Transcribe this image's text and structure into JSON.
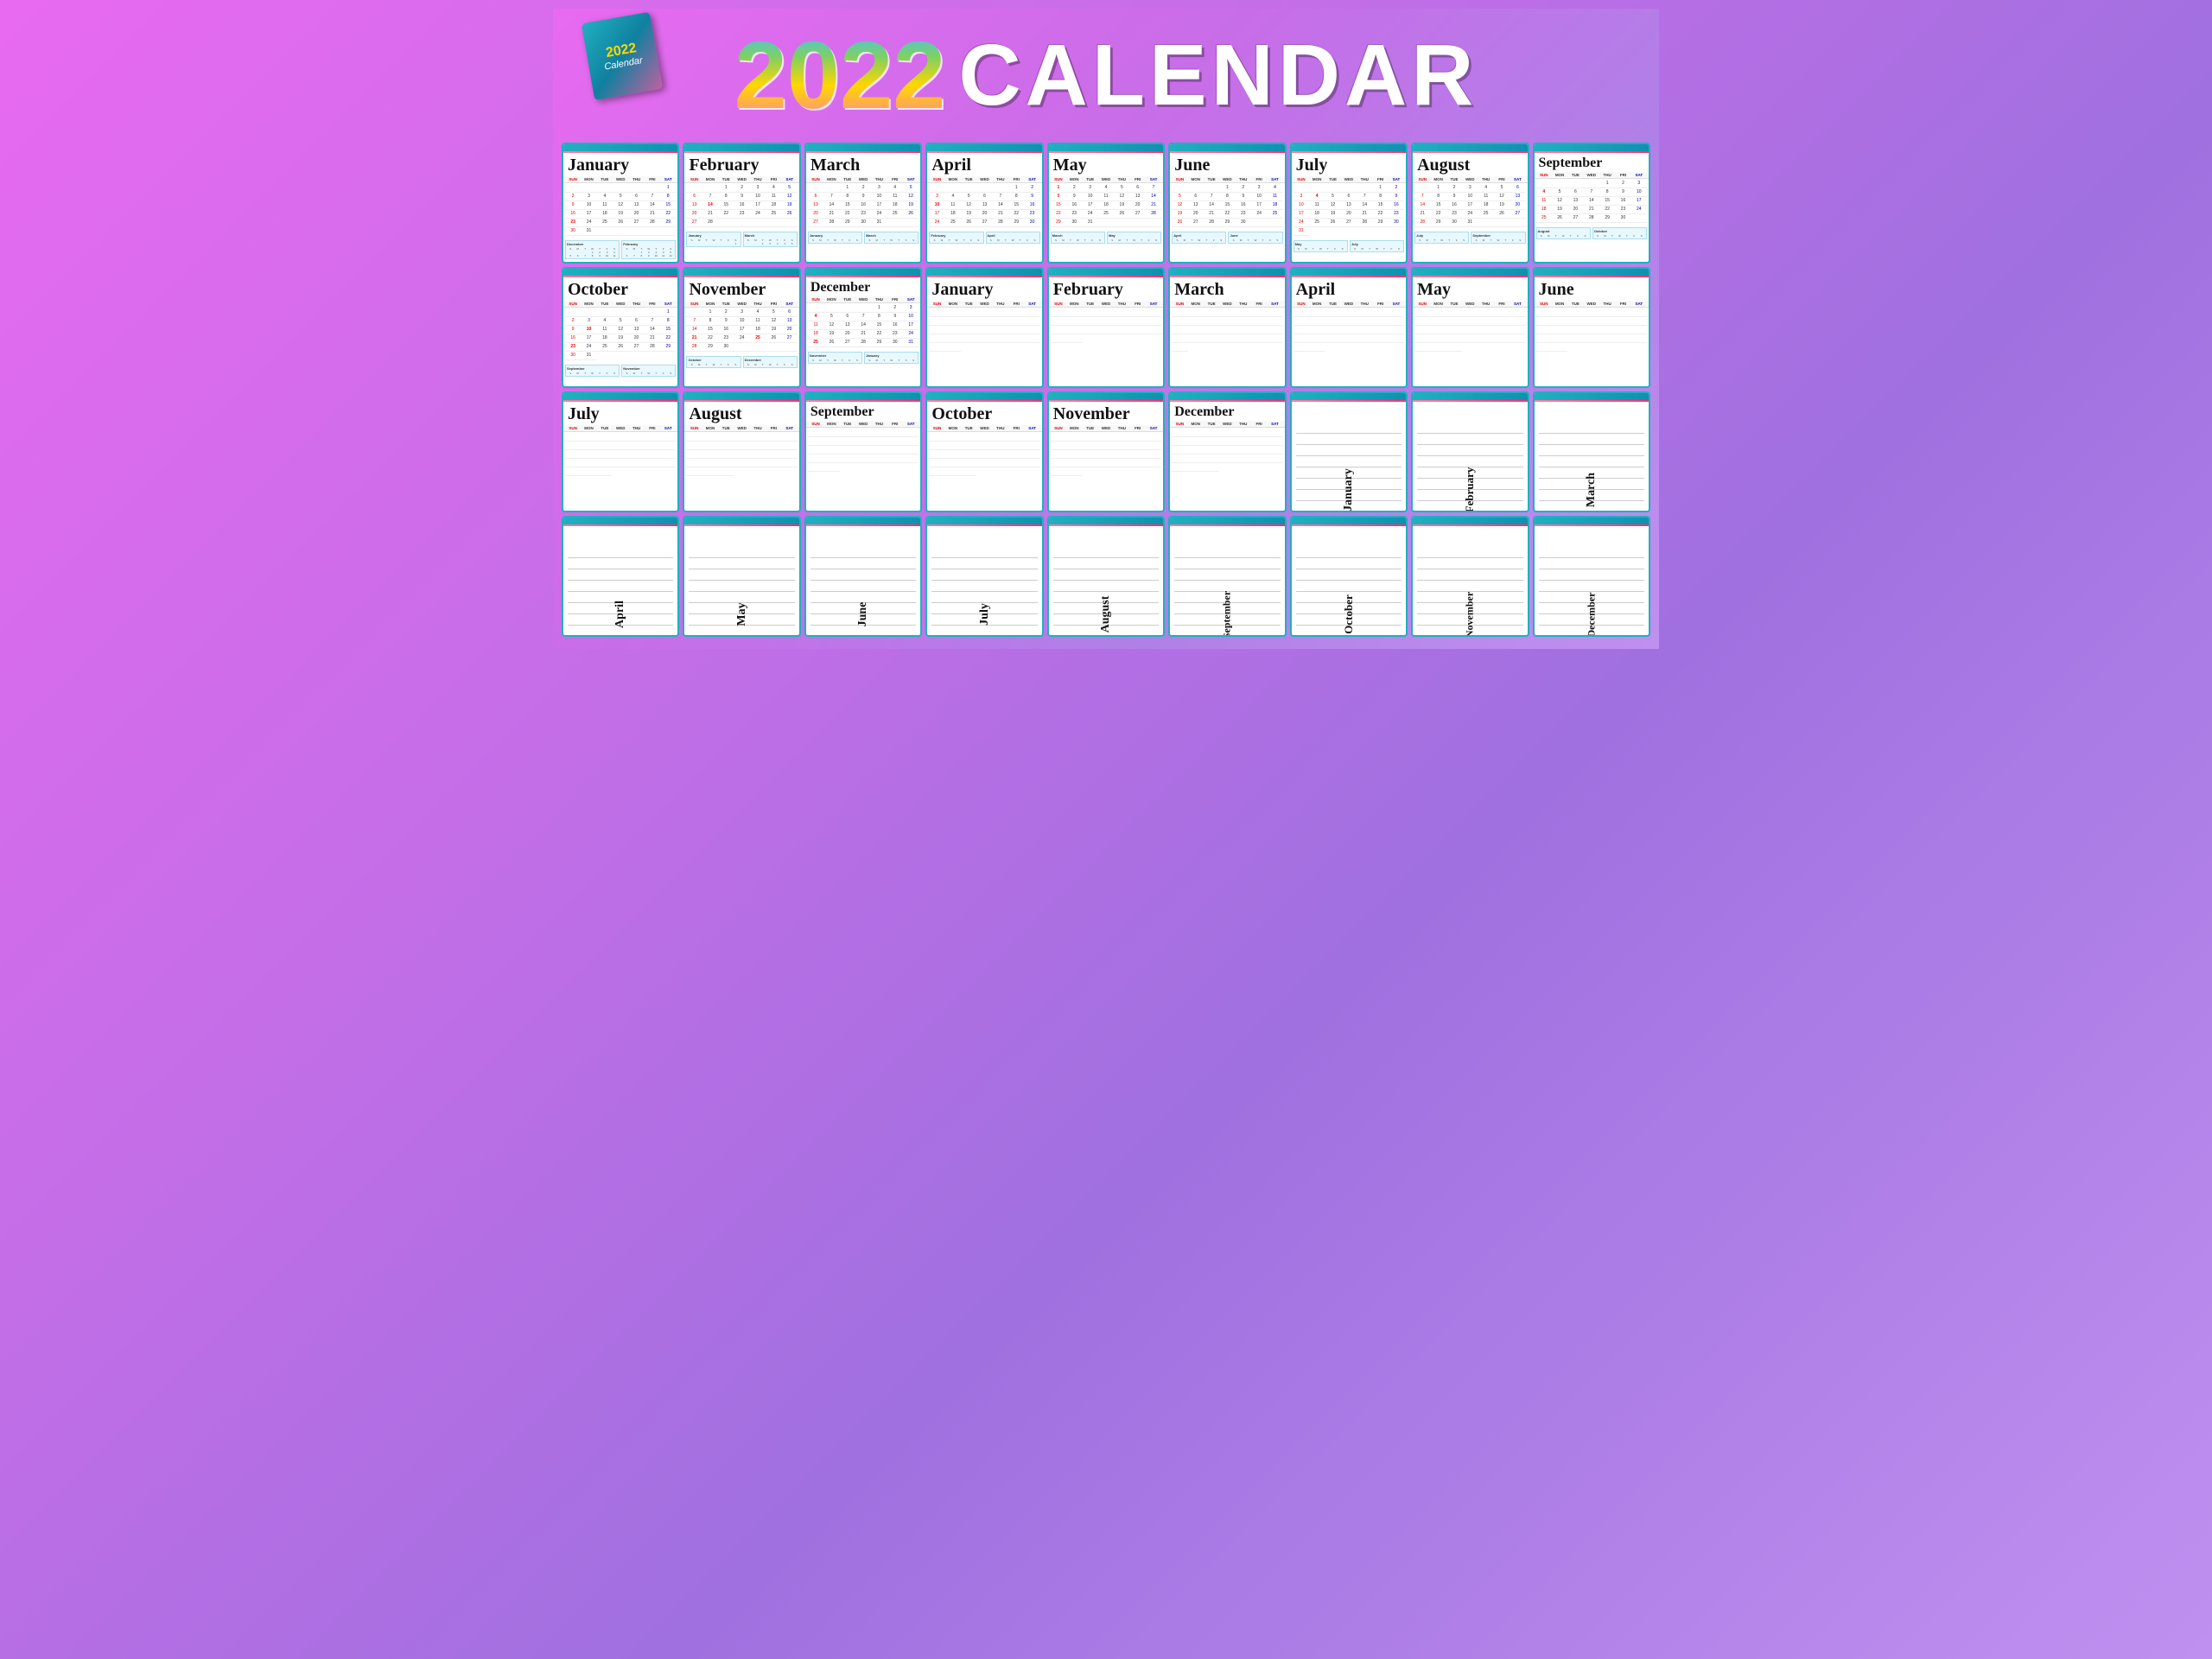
{
  "title": "2022 CALENDAR",
  "year": "2022",
  "subtitle": "Calendar",
  "header": {
    "year_label": "2022",
    "calendar_label": "CALENDAR",
    "year_number": "2022",
    "cal_word": "Calendar"
  },
  "row1_months": [
    {
      "name": "January",
      "size": "big"
    },
    {
      "name": "February",
      "size": "big"
    },
    {
      "name": "March",
      "size": "big"
    },
    {
      "name": "April",
      "size": "big"
    },
    {
      "name": "May",
      "size": "big"
    },
    {
      "name": "June",
      "size": "big"
    },
    {
      "name": "July",
      "size": "big"
    },
    {
      "name": "August",
      "size": "big"
    },
    {
      "name": "September",
      "size": "medium"
    }
  ],
  "row2_months": [
    {
      "name": "October",
      "size": "big"
    },
    {
      "name": "November",
      "size": "big"
    },
    {
      "name": "December",
      "size": "medium"
    },
    {
      "name": "January",
      "size": "big"
    },
    {
      "name": "February",
      "size": "big"
    },
    {
      "name": "March",
      "size": "big"
    },
    {
      "name": "April",
      "size": "big"
    },
    {
      "name": "May",
      "size": "big"
    },
    {
      "name": "June",
      "size": "big"
    }
  ],
  "row3_months": [
    {
      "name": "July",
      "size": "big"
    },
    {
      "name": "August",
      "size": "big"
    },
    {
      "name": "September",
      "size": "medium"
    },
    {
      "name": "October",
      "size": "big"
    },
    {
      "name": "November",
      "size": "big"
    },
    {
      "name": "December",
      "size": "medium"
    }
  ],
  "row3_rotated": [
    {
      "name": "January"
    },
    {
      "name": "February"
    },
    {
      "name": "March"
    }
  ],
  "row4_rotated": [
    {
      "name": "April"
    },
    {
      "name": "May"
    },
    {
      "name": "June"
    },
    {
      "name": "July"
    },
    {
      "name": "August"
    },
    {
      "name": "September"
    },
    {
      "name": "October"
    },
    {
      "name": "November"
    },
    {
      "name": "December"
    }
  ],
  "day_headers": [
    "SUN",
    "MON",
    "TUE",
    "WED",
    "THU",
    "FRI",
    "SAT"
  ]
}
